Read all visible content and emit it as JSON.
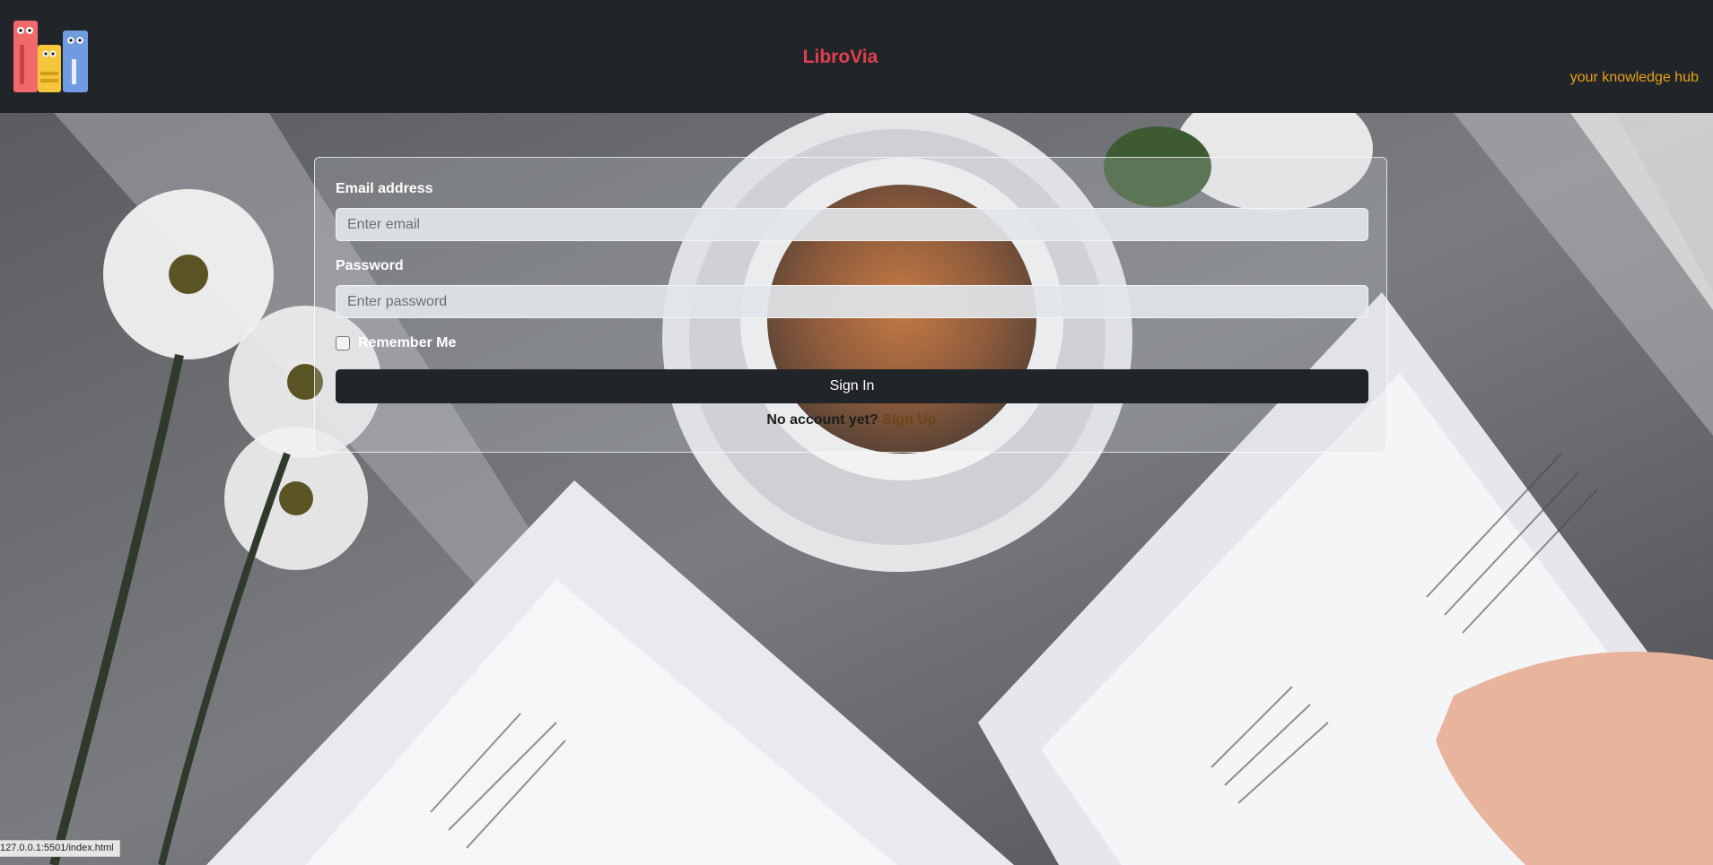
{
  "header": {
    "brand": "LibroVia",
    "tagline": "your knowledge hub",
    "logo_icon": "books-logo-icon"
  },
  "login": {
    "email_label": "Email address",
    "email_placeholder": "Enter email",
    "email_value": "",
    "password_label": "Password",
    "password_placeholder": "Enter password",
    "password_value": "",
    "remember_label": "Remember Me",
    "remember_checked": false,
    "signin_label": "Sign In",
    "no_account_text": "No account yet?",
    "signup_label": "Sign Up"
  },
  "status_bar": {
    "url": "127.0.0.1:5501/index.html"
  },
  "colors": {
    "header_bg": "#212428",
    "brand": "#e04150",
    "tagline": "#e8a319",
    "button_bg": "#212428",
    "signup_link": "#6b4616"
  }
}
